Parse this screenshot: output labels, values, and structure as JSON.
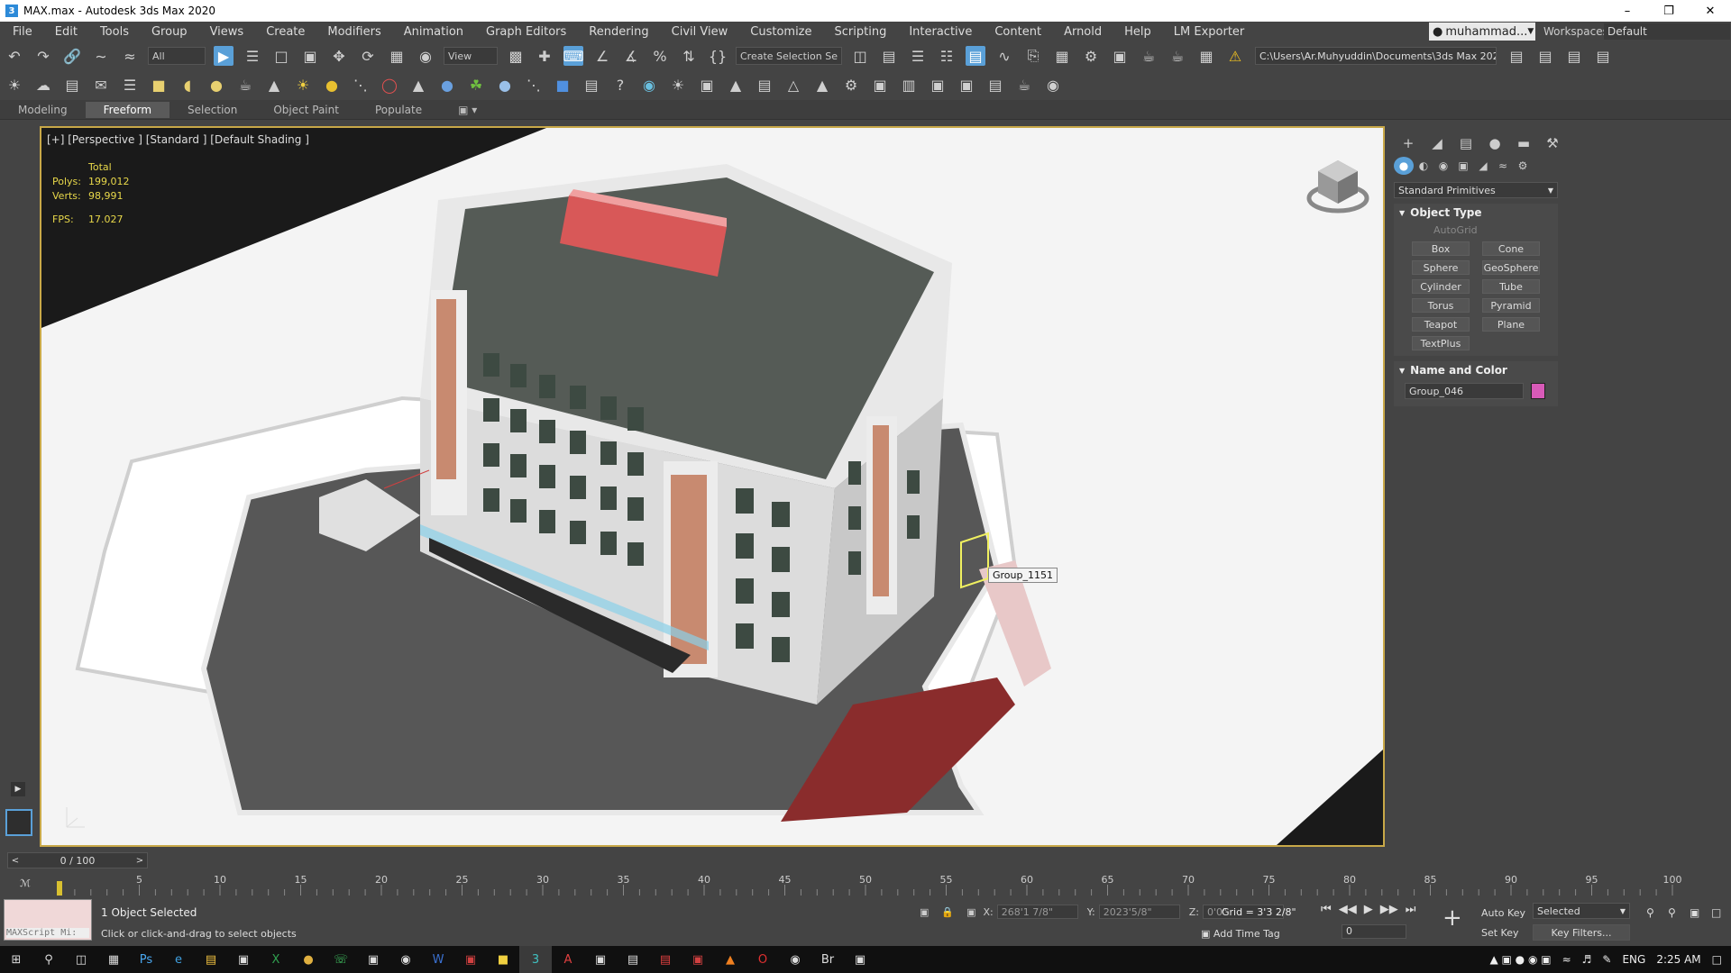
{
  "window": {
    "title": "MAX.max - Autodesk 3ds Max 2020",
    "app_icon": "3",
    "minimize": "–",
    "restore": "❐",
    "close": "✕"
  },
  "menu": {
    "items": [
      "File",
      "Edit",
      "Tools",
      "Group",
      "Views",
      "Create",
      "Modifiers",
      "Animation",
      "Graph Editors",
      "Rendering",
      "Civil View",
      "Customize",
      "Scripting",
      "Interactive",
      "Content",
      "Arnold",
      "Help",
      "LM Exporter"
    ],
    "user": "muhammad...",
    "workspaces_label": "Workspaces:",
    "workspace_value": "Default"
  },
  "toolbar": {
    "filter_value": "All",
    "refcoord_value": "View",
    "selection_set_value": "Create Selection Se",
    "project_path": "C:\\Users\\Ar.Muhyuddin\\Documents\\3ds Max 2020"
  },
  "ribbon": {
    "tabs": [
      "Modeling",
      "Freeform",
      "Selection",
      "Object Paint",
      "Populate"
    ],
    "active_tab": "Freeform"
  },
  "viewport": {
    "label": "[+] [Perspective ] [Standard ] [Default Shading ]",
    "stats_header": "Total",
    "polys_label": "Polys:",
    "polys_value": "199,012",
    "verts_label": "Verts:",
    "verts_value": "98,991",
    "fps_label": "FPS:",
    "fps_value": "17.027",
    "hover_label": "Group_1151"
  },
  "command_panel": {
    "primitive_type": "Standard Primitives",
    "object_type_title": "Object Type",
    "autogrid_label": "AutoGrid",
    "buttons": [
      "Box",
      "Cone",
      "Sphere",
      "GeoSphere",
      "Cylinder",
      "Tube",
      "Torus",
      "Pyramid",
      "Teapot",
      "Plane",
      "TextPlus"
    ],
    "name_color_title": "Name and Color",
    "object_name": "Group_046",
    "object_color": "#d85ab8"
  },
  "timeline": {
    "slider_text": "0 / 100",
    "ticks": [
      "0",
      "5",
      "10",
      "15",
      "20",
      "25",
      "30",
      "35",
      "40",
      "45",
      "50",
      "55",
      "60",
      "65",
      "70",
      "75",
      "80",
      "85",
      "90",
      "95",
      "100"
    ]
  },
  "status": {
    "maxscript_text": "MAXScript Mi:",
    "selection_text": "1 Object Selected",
    "prompt_text": "Click or click-and-drag to select objects",
    "x_label": "X:",
    "x_value": "268'1 7/8\"",
    "y_label": "Y:",
    "y_value": "2023'5/8\"",
    "z_label": "Z:",
    "z_value": "0'0\"",
    "grid_text": "Grid = 3'3 2/8\"",
    "add_time_tag": "Add Time Tag",
    "frame_value": "0",
    "auto_key": "Auto Key",
    "set_key": "Set Key",
    "selected_value": "Selected",
    "key_filters": "Key Filters..."
  },
  "taskbar": {
    "language": "ENG",
    "time": "2:25 AM"
  }
}
